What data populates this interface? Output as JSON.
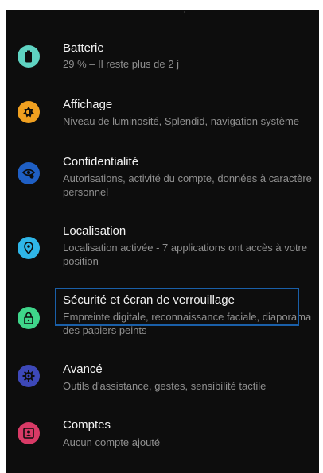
{
  "settings": {
    "items": [
      {
        "title": "Batterie",
        "subtitle": "29 % – Il reste plus de 2 j",
        "icon": "battery-icon",
        "color": "#5fd3c2"
      },
      {
        "title": "Affichage",
        "subtitle": "Niveau de luminosité, Splendid, navigation système",
        "icon": "brightness-icon",
        "color": "#f0a020"
      },
      {
        "title": "Confidentialité",
        "subtitle": "Autorisations, activité du compte, données à caractère personnel",
        "icon": "privacy-eye-icon",
        "color": "#1f5fc4"
      },
      {
        "title": "Localisation",
        "subtitle": "Localisation activée - 7 applications ont accès à votre position",
        "icon": "location-pin-icon",
        "color": "#2fb6e8"
      },
      {
        "title": "Sécurité et écran de verrouillage",
        "subtitle": "Empreinte digitale, reconnaissance faciale, diaporama des papiers peints",
        "icon": "lock-icon",
        "color": "#3fd58a"
      },
      {
        "title": "Avancé",
        "subtitle": "Outils d'assistance, gestes, sensibilité tactile",
        "icon": "gear-icon",
        "color": "#3d48b8"
      },
      {
        "title": "Comptes",
        "subtitle": "Aucun compte ajouté",
        "icon": "account-box-icon",
        "color": "#d83a66"
      }
    ]
  }
}
